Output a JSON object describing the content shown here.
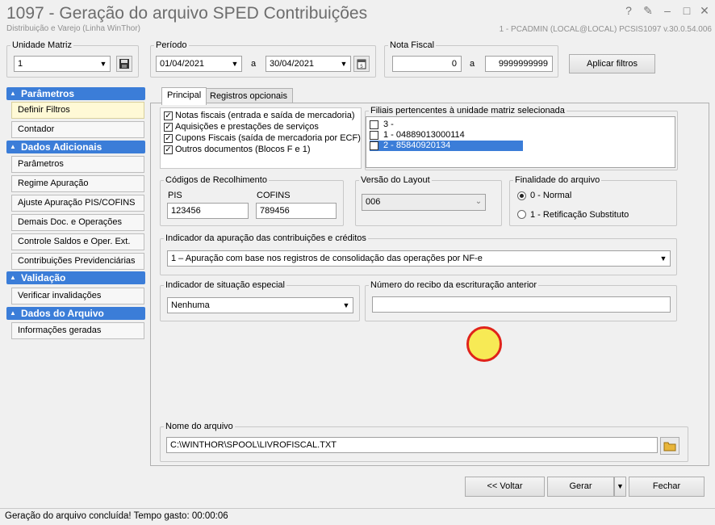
{
  "window": {
    "title": "1097 - Geração do arquivo SPED Contribuições",
    "subtitle": "Distribuição e Varejo (Linha WinThor)",
    "info": "1 - PCADMIN (LOCAL@LOCAL)    PCSIS1097  v.30.0.54.006"
  },
  "toolbar": {
    "unidade_matriz": {
      "label": "Unidade Matriz",
      "value": "1"
    },
    "periodo": {
      "label": "Período",
      "start": "01/04/2021",
      "sep": "a",
      "end": "30/04/2021"
    },
    "nota_fiscal": {
      "label": "Nota Fiscal",
      "start": "0",
      "sep": "a",
      "end": "9999999999"
    },
    "apply_label": "Aplicar filtros"
  },
  "sidebar": {
    "groups": [
      {
        "title": "Parâmetros",
        "items": [
          "Definir Filtros",
          "Contador"
        ]
      },
      {
        "title": "Dados Adicionais",
        "items": [
          "Parâmetros",
          "Regime Apuração",
          "Ajuste Apuração PIS/COFINS",
          "Demais Doc. e Operações",
          "Controle Saldos e Oper. Ext.",
          "Contribuições Previdenciárias"
        ]
      },
      {
        "title": "Validação",
        "items": [
          "Verificar invalidações"
        ]
      },
      {
        "title": "Dados do Arquivo",
        "items": [
          "Informações geradas"
        ]
      }
    ]
  },
  "tabs": [
    "Principal",
    "Registros opcionais"
  ],
  "documents": [
    {
      "label": "Notas fiscais (entrada e saída de mercadoria)",
      "checked": true
    },
    {
      "label": "Aquisições e prestações de serviços",
      "checked": true
    },
    {
      "label": "Cupons Fiscais (saída de mercadoria por ECF)",
      "checked": true
    },
    {
      "label": "Outros documentos (Blocos F e 1)",
      "checked": true
    }
  ],
  "filiais": {
    "label": "Filiais pertencentes à unidade matriz selecionada",
    "items": [
      {
        "text": "3 -",
        "checked": false,
        "selected": false
      },
      {
        "text": "1 - 04889013000114",
        "checked": false,
        "selected": false
      },
      {
        "text": "2 - 85840920134",
        "checked": false,
        "selected": true
      }
    ]
  },
  "recolhimento": {
    "label": "Códigos de Recolhimento",
    "pis_label": "PIS",
    "pis": "123456",
    "cofins_label": "COFINS",
    "cofins": "789456"
  },
  "layout": {
    "label": "Versão do Layout",
    "value": "006"
  },
  "finalidade": {
    "label": "Finalidade do arquivo",
    "options": [
      "0 - Normal",
      "1 - Retificação Substituto"
    ],
    "selected": 0
  },
  "indicador_apuracao": {
    "label": "Indicador da apuração das contribuições e créditos",
    "value": "1 – Apuração com base nos registros de consolidação das operações por NF-e"
  },
  "situacao": {
    "label": "Indicador de situação especial",
    "value": "Nenhuma"
  },
  "recibo": {
    "label": "Número do recibo da escrituração anterior",
    "value": ""
  },
  "arquivo": {
    "label": "Nome do arquivo",
    "value": "C:\\WINTHOR\\SPOOL\\LIVROFISCAL.TXT"
  },
  "buttons": {
    "voltar": "<< Voltar",
    "gerar": "Gerar",
    "fechar": "Fechar"
  },
  "status": "Geração do arquivo concluída! Tempo gasto: 00:00:06",
  "colors": {
    "accent": "#3b7dd8",
    "cursor_fill": "#f7ea55",
    "cursor_ring": "#e0231a"
  }
}
